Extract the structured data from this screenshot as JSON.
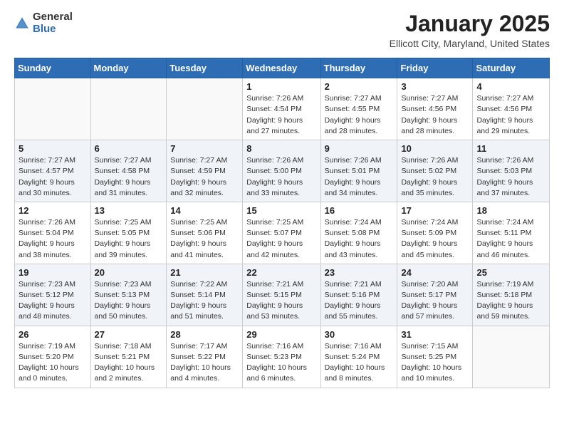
{
  "header": {
    "logo_general": "General",
    "logo_blue": "Blue",
    "month_title": "January 2025",
    "location": "Ellicott City, Maryland, United States"
  },
  "weekdays": [
    "Sunday",
    "Monday",
    "Tuesday",
    "Wednesday",
    "Thursday",
    "Friday",
    "Saturday"
  ],
  "weeks": [
    [
      {
        "day": "",
        "info": ""
      },
      {
        "day": "",
        "info": ""
      },
      {
        "day": "",
        "info": ""
      },
      {
        "day": "1",
        "info": "Sunrise: 7:26 AM\nSunset: 4:54 PM\nDaylight: 9 hours\nand 27 minutes."
      },
      {
        "day": "2",
        "info": "Sunrise: 7:27 AM\nSunset: 4:55 PM\nDaylight: 9 hours\nand 28 minutes."
      },
      {
        "day": "3",
        "info": "Sunrise: 7:27 AM\nSunset: 4:56 PM\nDaylight: 9 hours\nand 28 minutes."
      },
      {
        "day": "4",
        "info": "Sunrise: 7:27 AM\nSunset: 4:56 PM\nDaylight: 9 hours\nand 29 minutes."
      }
    ],
    [
      {
        "day": "5",
        "info": "Sunrise: 7:27 AM\nSunset: 4:57 PM\nDaylight: 9 hours\nand 30 minutes."
      },
      {
        "day": "6",
        "info": "Sunrise: 7:27 AM\nSunset: 4:58 PM\nDaylight: 9 hours\nand 31 minutes."
      },
      {
        "day": "7",
        "info": "Sunrise: 7:27 AM\nSunset: 4:59 PM\nDaylight: 9 hours\nand 32 minutes."
      },
      {
        "day": "8",
        "info": "Sunrise: 7:26 AM\nSunset: 5:00 PM\nDaylight: 9 hours\nand 33 minutes."
      },
      {
        "day": "9",
        "info": "Sunrise: 7:26 AM\nSunset: 5:01 PM\nDaylight: 9 hours\nand 34 minutes."
      },
      {
        "day": "10",
        "info": "Sunrise: 7:26 AM\nSunset: 5:02 PM\nDaylight: 9 hours\nand 35 minutes."
      },
      {
        "day": "11",
        "info": "Sunrise: 7:26 AM\nSunset: 5:03 PM\nDaylight: 9 hours\nand 37 minutes."
      }
    ],
    [
      {
        "day": "12",
        "info": "Sunrise: 7:26 AM\nSunset: 5:04 PM\nDaylight: 9 hours\nand 38 minutes."
      },
      {
        "day": "13",
        "info": "Sunrise: 7:25 AM\nSunset: 5:05 PM\nDaylight: 9 hours\nand 39 minutes."
      },
      {
        "day": "14",
        "info": "Sunrise: 7:25 AM\nSunset: 5:06 PM\nDaylight: 9 hours\nand 41 minutes."
      },
      {
        "day": "15",
        "info": "Sunrise: 7:25 AM\nSunset: 5:07 PM\nDaylight: 9 hours\nand 42 minutes."
      },
      {
        "day": "16",
        "info": "Sunrise: 7:24 AM\nSunset: 5:08 PM\nDaylight: 9 hours\nand 43 minutes."
      },
      {
        "day": "17",
        "info": "Sunrise: 7:24 AM\nSunset: 5:09 PM\nDaylight: 9 hours\nand 45 minutes."
      },
      {
        "day": "18",
        "info": "Sunrise: 7:24 AM\nSunset: 5:11 PM\nDaylight: 9 hours\nand 46 minutes."
      }
    ],
    [
      {
        "day": "19",
        "info": "Sunrise: 7:23 AM\nSunset: 5:12 PM\nDaylight: 9 hours\nand 48 minutes."
      },
      {
        "day": "20",
        "info": "Sunrise: 7:23 AM\nSunset: 5:13 PM\nDaylight: 9 hours\nand 50 minutes."
      },
      {
        "day": "21",
        "info": "Sunrise: 7:22 AM\nSunset: 5:14 PM\nDaylight: 9 hours\nand 51 minutes."
      },
      {
        "day": "22",
        "info": "Sunrise: 7:21 AM\nSunset: 5:15 PM\nDaylight: 9 hours\nand 53 minutes."
      },
      {
        "day": "23",
        "info": "Sunrise: 7:21 AM\nSunset: 5:16 PM\nDaylight: 9 hours\nand 55 minutes."
      },
      {
        "day": "24",
        "info": "Sunrise: 7:20 AM\nSunset: 5:17 PM\nDaylight: 9 hours\nand 57 minutes."
      },
      {
        "day": "25",
        "info": "Sunrise: 7:19 AM\nSunset: 5:18 PM\nDaylight: 9 hours\nand 59 minutes."
      }
    ],
    [
      {
        "day": "26",
        "info": "Sunrise: 7:19 AM\nSunset: 5:20 PM\nDaylight: 10 hours\nand 0 minutes."
      },
      {
        "day": "27",
        "info": "Sunrise: 7:18 AM\nSunset: 5:21 PM\nDaylight: 10 hours\nand 2 minutes."
      },
      {
        "day": "28",
        "info": "Sunrise: 7:17 AM\nSunset: 5:22 PM\nDaylight: 10 hours\nand 4 minutes."
      },
      {
        "day": "29",
        "info": "Sunrise: 7:16 AM\nSunset: 5:23 PM\nDaylight: 10 hours\nand 6 minutes."
      },
      {
        "day": "30",
        "info": "Sunrise: 7:16 AM\nSunset: 5:24 PM\nDaylight: 10 hours\nand 8 minutes."
      },
      {
        "day": "31",
        "info": "Sunrise: 7:15 AM\nSunset: 5:25 PM\nDaylight: 10 hours\nand 10 minutes."
      },
      {
        "day": "",
        "info": ""
      }
    ]
  ]
}
